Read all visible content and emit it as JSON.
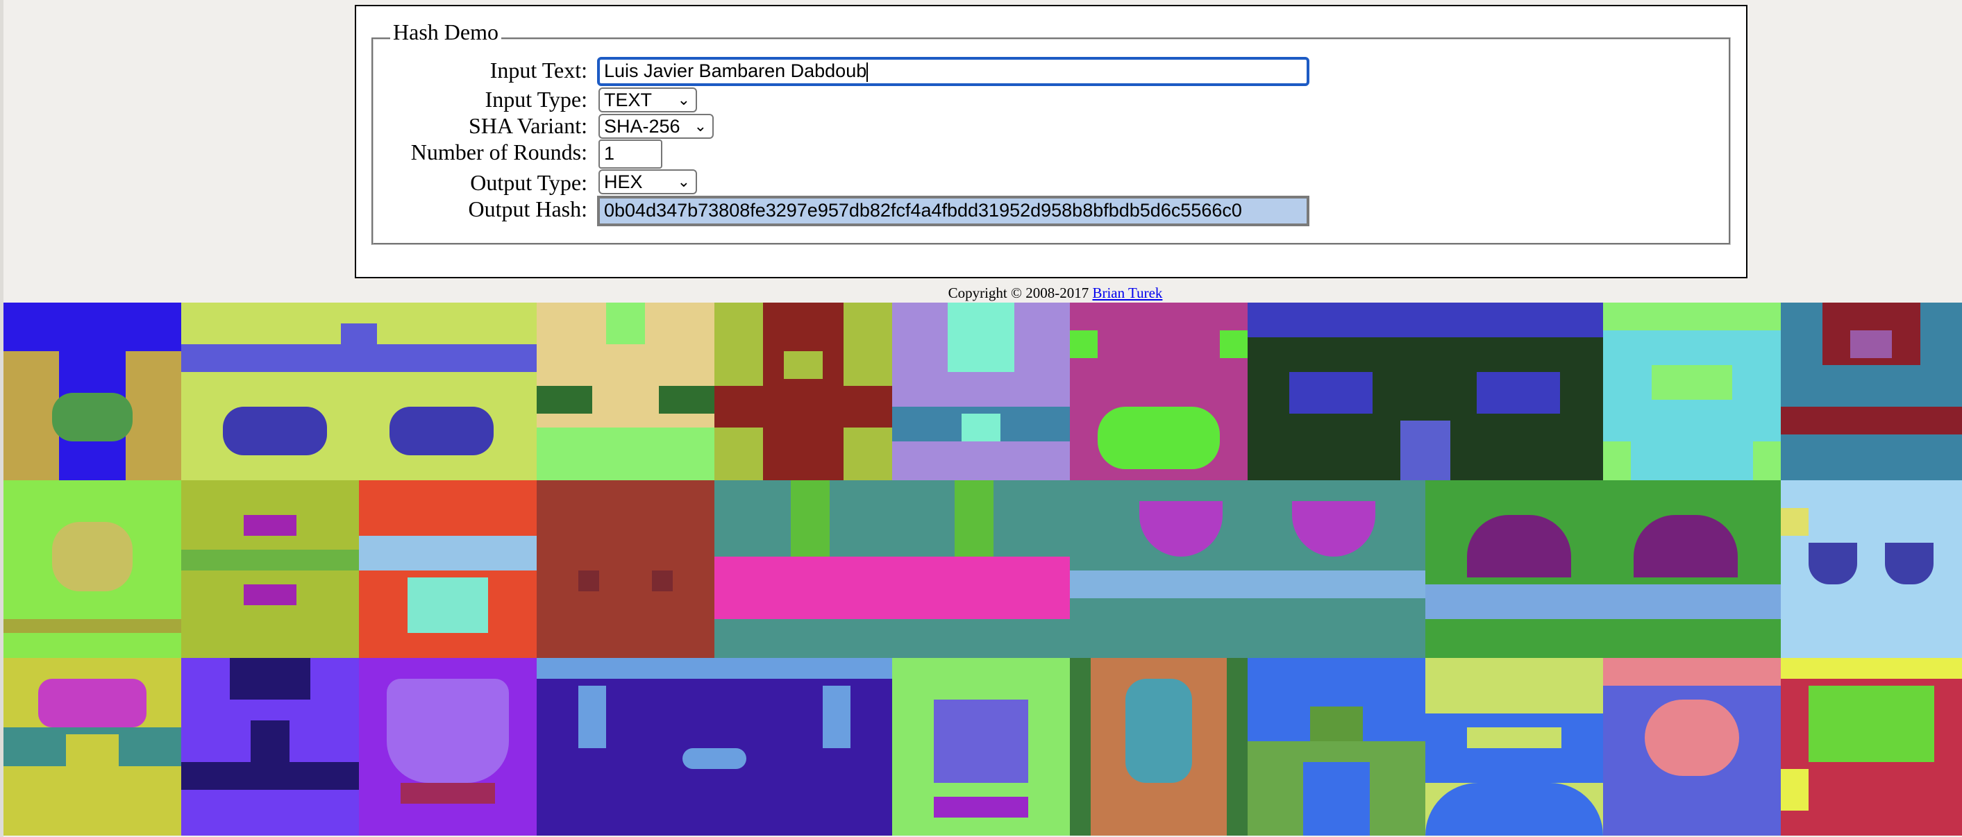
{
  "form": {
    "legend": "Hash Demo",
    "labels": {
      "input_text": "Input Text:",
      "input_type": "Input Type:",
      "sha_variant": "SHA Variant:",
      "rounds": "Number of Rounds:",
      "output_type": "Output Type:",
      "output_hash": "Output Hash:"
    },
    "input_text_value": "Luis Javier Bambaren Dabdoub",
    "input_type_value": "TEXT",
    "sha_variant_value": "SHA-256",
    "rounds_value": "1",
    "output_type_value": "HEX",
    "output_hash_value": "0b04d347b73808fe3297e957db82fcf4a4fbdd31952d958b8bfbdb5d6c5566c0"
  },
  "footer": {
    "copyright_text": "Copyright © 2008-2017 ",
    "author_link": "Brian Turek"
  },
  "icons": {
    "dropdown": "chevron-down-icon"
  },
  "mosaic_colors": [
    [
      "#2a18e6",
      "#c8e060",
      "#8cf072",
      "#8a241f",
      "#a58bdb",
      "#b23d8f",
      "#1f3d1f",
      "#6ad9e0",
      "#3b83a3"
    ],
    [
      "#8ae84d",
      "#a8bf37",
      "#e64a2d",
      "#9c3b2f",
      "#ea38b3",
      "#4a948b",
      "#42a33b",
      "#a6d5f2"
    ],
    [
      "#c9cc3f",
      "#6f3df2",
      "#9b66ee",
      "#3a1aa3",
      "#8ae86a",
      "#c47a4c",
      "#3a6fe9",
      "#c9e06a",
      "#5a62d9",
      "#69d63a"
    ]
  ]
}
